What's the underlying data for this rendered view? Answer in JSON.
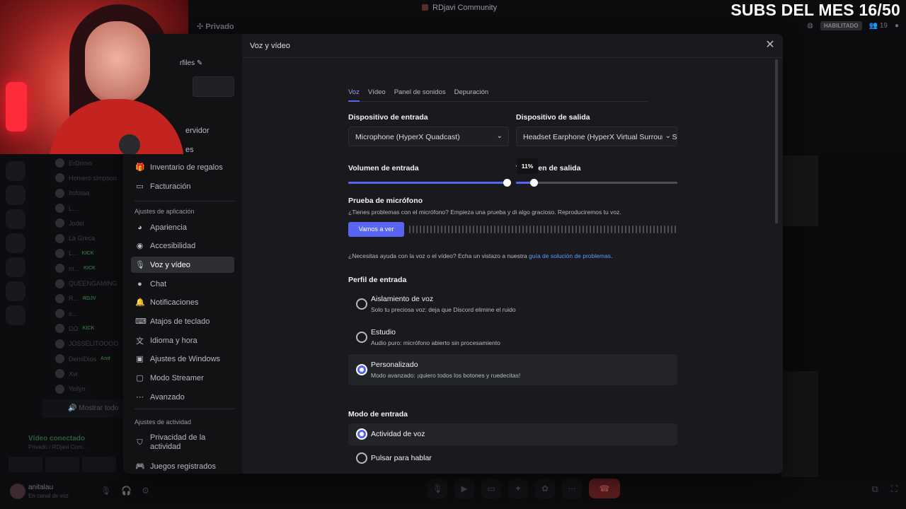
{
  "overlay": {
    "subs_text": "SUBS DEL MES 16/50"
  },
  "topbar": {
    "server_title": "RDjavi Community"
  },
  "channel_header": {
    "channel": "Privado",
    "badge": "HABILITADO",
    "member_count": "19"
  },
  "left_bg": {
    "members": [
      {
        "name": "ErDrimo",
        "tag": ""
      },
      {
        "name": "Homero simpson",
        "tag": ""
      },
      {
        "name": "Itsfotaa",
        "tag": ""
      },
      {
        "name": "L...",
        "tag": ""
      },
      {
        "name": "Jodel",
        "tag": ""
      },
      {
        "name": "La Greca",
        "tag": ""
      },
      {
        "name": "L...",
        "tag": "KICK"
      },
      {
        "name": "m...",
        "tag": "KICK"
      },
      {
        "name": "QUEENGAMING",
        "tag": ""
      },
      {
        "name": "R...",
        "tag": "RDJV"
      },
      {
        "name": "s...",
        "tag": ""
      },
      {
        "name": "ΩΩ",
        "tag": "KICK"
      },
      {
        "name": "JOSSELITOOOO",
        "tag": ""
      },
      {
        "name": "DemiDios",
        "tag": "And"
      },
      {
        "name": "Xvi",
        "tag": ""
      },
      {
        "name": "Yeilyn",
        "tag": ""
      }
    ],
    "show_all": "Mostrar todo",
    "voice": {
      "title": "Vídeo conectado",
      "subtitle": "Privado / RDjavi Com..."
    },
    "user": {
      "name": "anitalau",
      "status": "En canal de voz"
    }
  },
  "modal": {
    "title": "Voz y vídeo",
    "close_icon": "close-icon",
    "sidebar": {
      "fragment_profiles": "rfiles ✎",
      "fragment_server": "ervidor",
      "fragment_es": "es",
      "billing_items": [
        {
          "label": "Inventario de regalos",
          "icon": "gift-icon"
        },
        {
          "label": "Facturación",
          "icon": "card-icon"
        }
      ],
      "app_section_label": "Ajustes de aplicación",
      "app_items": [
        {
          "label": "Apariencia",
          "icon": "palette-icon"
        },
        {
          "label": "Accesibilidad",
          "icon": "accessibility-icon"
        },
        {
          "label": "Voz y vídeo",
          "icon": "mic-icon"
        },
        {
          "label": "Chat",
          "icon": "chat-icon"
        },
        {
          "label": "Notificaciones",
          "icon": "bell-icon"
        },
        {
          "label": "Atajos de teclado",
          "icon": "keyboard-icon"
        },
        {
          "label": "Idioma y hora",
          "icon": "language-icon"
        },
        {
          "label": "Ajustes de Windows",
          "icon": "windows-icon"
        },
        {
          "label": "Modo Streamer",
          "icon": "streamer-icon"
        },
        {
          "label": "Avanzado",
          "icon": "more-icon"
        }
      ],
      "activity_section_label": "Ajustes de actividad",
      "activity_items": [
        {
          "label": "Privacidad de la actividad",
          "icon": "shield-icon"
        },
        {
          "label": "Juegos registrados",
          "icon": "gamepad-icon"
        }
      ]
    },
    "tabs": [
      "Voz",
      "Vídeo",
      "Panel de sonidos",
      "Depuración"
    ],
    "input_device": {
      "label": "Dispositivo de entrada",
      "value": "Microphone (HyperX Quadcast)"
    },
    "output_device": {
      "label": "Dispositivo de salida",
      "value": "Headset Earphone (HyperX Virtual Surround Sound)"
    },
    "input_volume": {
      "label": "Volumen de entrada",
      "level_pct": 100
    },
    "output_volume": {
      "label": "Volumen de salida",
      "level_pct": 11,
      "tooltip": "11%"
    },
    "mic_test": {
      "title": "Prueba de micrófono",
      "description": "¿Tienes problemas con el micrófono? Empieza una prueba y di algo gracioso. Reproduciremos tu voz.",
      "button": "Vamos a ver"
    },
    "help": {
      "text": "¿Necesitas ayuda con la voz o el vídeo? Echa un vistazo a nuestra ",
      "link": "guía de solución de problemas",
      "end": "."
    },
    "input_profile": {
      "title": "Perfil de entrada",
      "options": [
        {
          "title": "Aislamiento de voz",
          "subtitle": "Solo tu preciosa voz: deja que Discord elimine el ruido",
          "selected": false
        },
        {
          "title": "Estudio",
          "subtitle": "Audio puro: micrófono abierto sin procesamiento",
          "selected": false
        },
        {
          "title": "Personalizado",
          "subtitle": "Modo avanzado: ¡quiero todos los botones y ruedecitas!",
          "selected": true
        }
      ]
    },
    "input_mode": {
      "title": "Modo de entrada",
      "options": [
        {
          "title": "Actividad de voz",
          "selected": true
        },
        {
          "title": "Pulsar para hablar",
          "selected": false
        }
      ]
    }
  }
}
